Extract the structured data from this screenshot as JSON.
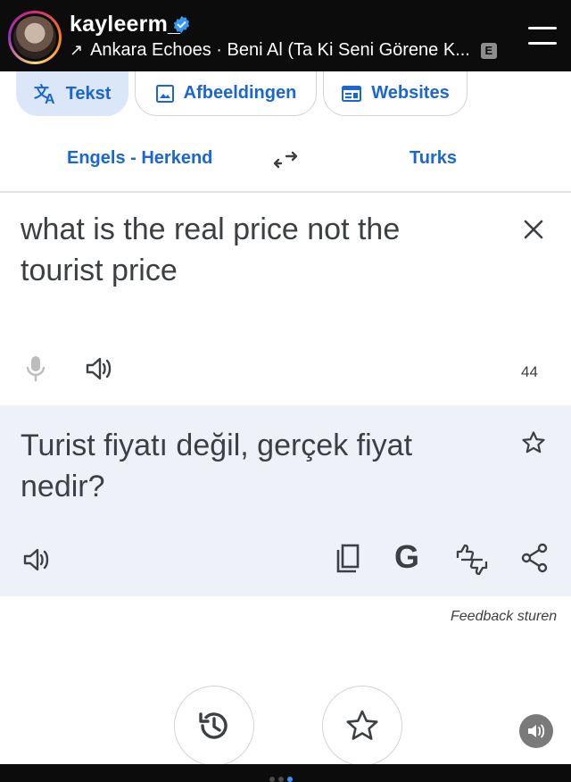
{
  "story_header": {
    "username": "kayleerm_",
    "music": "Ankara Echoes · Beni Al (Ta Ki Seni Görene K...",
    "explicit_badge": "E"
  },
  "tabs": [
    {
      "label": "Tekst",
      "icon": "translate-icon",
      "active": true
    },
    {
      "label": "Afbeeldingen",
      "icon": "image-icon",
      "active": false
    },
    {
      "label": "Websites",
      "icon": "web-icon",
      "active": false
    }
  ],
  "languages": {
    "source": "Engels - Herkend",
    "target": "Turks"
  },
  "source": {
    "text": "what is the real price not the tourist price",
    "char_count": "44"
  },
  "translation": {
    "text": "Turist fiyatı değil, gerçek fiyat nedir?"
  },
  "feedback_label": "Feedback sturen",
  "bottom_buttons": [
    "history-icon",
    "star-icon"
  ],
  "colors": {
    "accent": "#1a66d2",
    "active_tab_bg": "#dbe6f8",
    "result_bg": "#eef1f8",
    "header_bg": "#0c0c0c"
  }
}
